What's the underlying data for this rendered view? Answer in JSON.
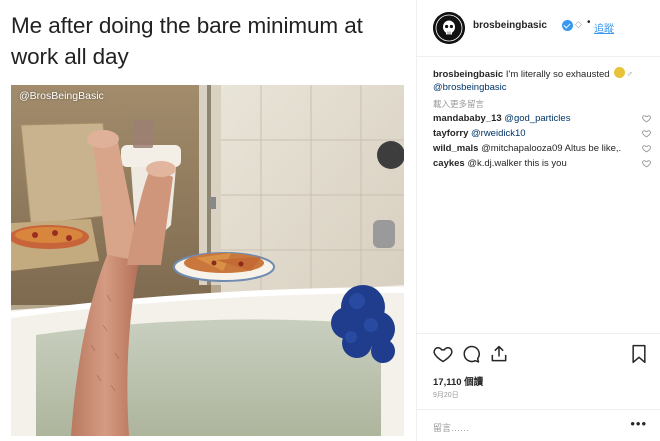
{
  "meme": {
    "caption": "Me after doing the bare minimum at work all day",
    "watermark": "@BrosBeingBasic"
  },
  "post": {
    "header": {
      "username": "brosbeingbasic",
      "more_indicator": "◇",
      "separator": "•",
      "follow_label": "追蹤"
    },
    "caption": {
      "username": "brosbeingbasic",
      "text": "I'm literally so exhausted",
      "gender_symbol": "♂",
      "mention": "@brosbeingbasic"
    },
    "load_more": "載入更多留言",
    "comments": [
      {
        "user": "mandababy_13",
        "text": "@god_particles"
      },
      {
        "user": "tayforry",
        "text": "@rweidick10"
      },
      {
        "user": "wild_mals",
        "text": "@mitchapalooza09 Altus be like,."
      },
      {
        "user": "caykes",
        "text": "@k.dj.walker this is you"
      }
    ],
    "views": "17,110 個讀",
    "date": "9月20日",
    "add_comment_placeholder": "留言……",
    "more_options": "•••"
  },
  "icons": {
    "like": "heart-icon",
    "comment": "comment-icon",
    "share": "share-icon",
    "save": "bookmark-icon"
  }
}
